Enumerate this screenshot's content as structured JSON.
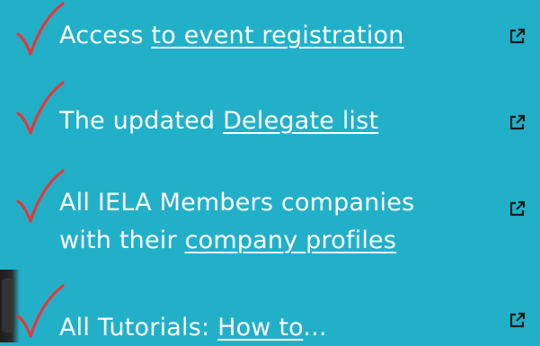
{
  "items": [
    {
      "prefix": "",
      "link": "to event registration",
      "suffix": "",
      "before": "Access "
    },
    {
      "before": "The updated ",
      "link": "Delegate list",
      "suffix": ""
    },
    {
      "line1": "All IELA Members companies",
      "line2_before": "with their ",
      "line2_link": "company profiles"
    },
    {
      "before": "All Tutorials: ",
      "link": "How to",
      "suffix": "..."
    }
  ],
  "colors": {
    "background": "#22b0c9",
    "check": "#e23a3a",
    "text": "#ffffff",
    "icon": "#1b1b1b"
  },
  "icons": {
    "check": "checkmark-icon",
    "external": "external-link-icon"
  }
}
